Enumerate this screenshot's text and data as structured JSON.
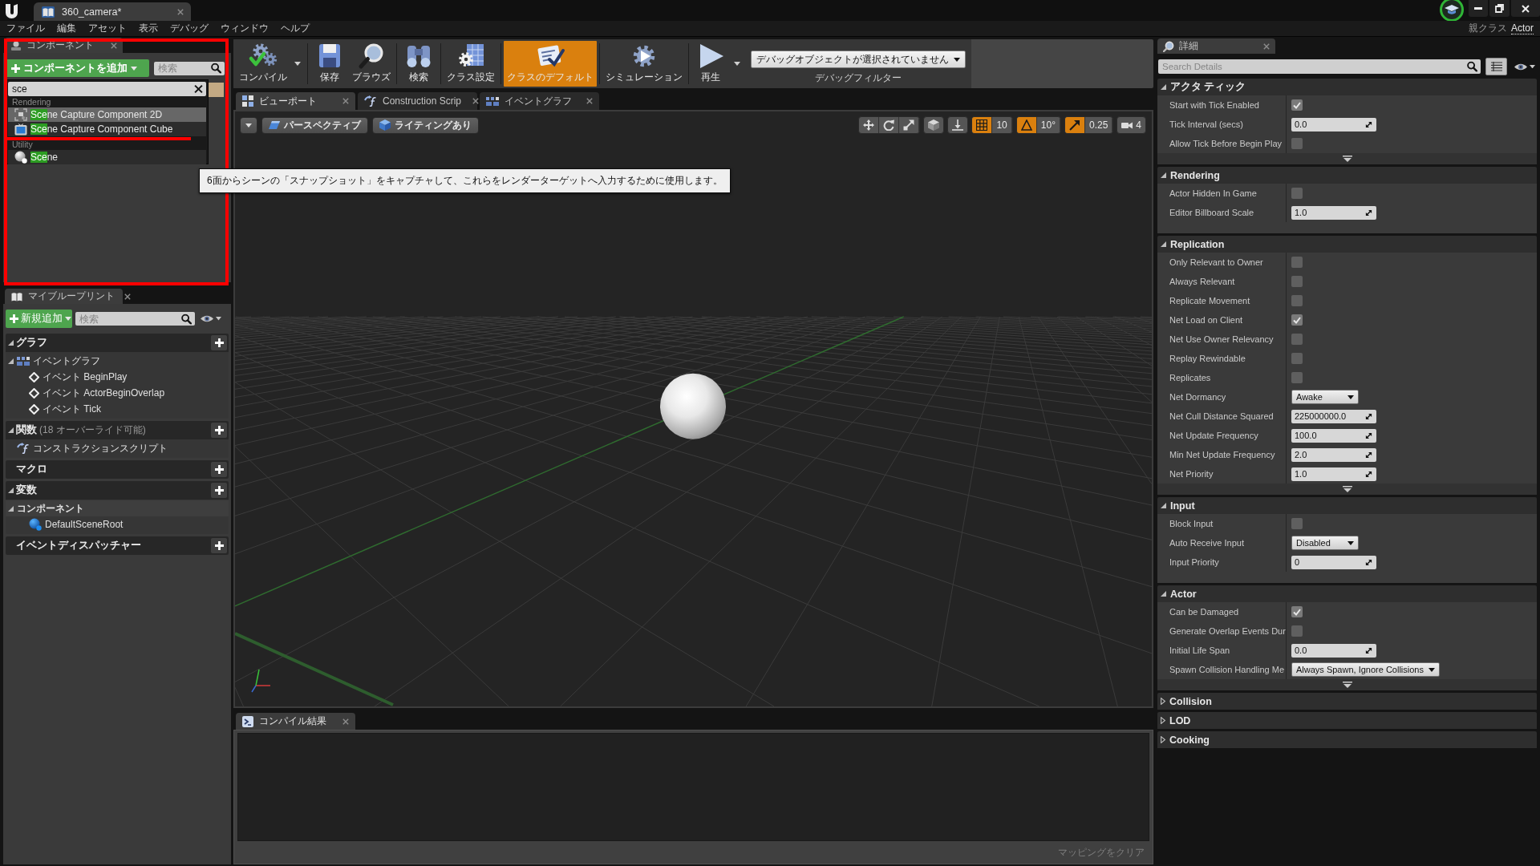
{
  "window": {
    "document_tab": "360_camera*",
    "parent_class_label": "親クラス",
    "parent_class": "Actor"
  },
  "menu": [
    "ファイル",
    "編集",
    "アセット",
    "表示",
    "デバッグ",
    "ウィンドウ",
    "ヘルプ"
  ],
  "components": {
    "tab": "コンポーネント",
    "add_button": "コンポーネントを追加",
    "search": {
      "placeholder": "検索"
    },
    "picker": {
      "query": "sce",
      "groups": [
        {
          "title": "Rendering",
          "items": [
            {
              "kind": "capture",
              "match": "Sce",
              "rest": "ne Capture Component 2D",
              "selected": true
            },
            {
              "kind": "monitor",
              "match": "Sce",
              "rest": "ne Capture Component Cube",
              "selected": false
            }
          ]
        },
        {
          "title": "Utility",
          "items": [
            {
              "kind": "sphere",
              "match": "Sce",
              "rest": "ne",
              "selected": false
            }
          ]
        }
      ]
    },
    "tooltip": "6面からシーンの「スナップショット」をキャプチャして、これらをレンダーターゲットへ入力するために使用します。"
  },
  "my_blueprint": {
    "tab": "マイブループリント",
    "add_button": "新規追加",
    "search": {
      "placeholder": "検索"
    },
    "sections": [
      {
        "title": "グラフ",
        "expanded": true,
        "add": true,
        "items": [
          {
            "kind": "graph",
            "label": "イベントグラフ",
            "expanded": true,
            "children": [
              {
                "kind": "event",
                "label": "イベント BeginPlay"
              },
              {
                "kind": "event",
                "label": "イベント ActorBeginOverlap"
              },
              {
                "kind": "event",
                "label": "イベント Tick"
              }
            ]
          }
        ]
      },
      {
        "title": "関数",
        "note": "(18 オーバーライド可能)",
        "expanded": true,
        "add": true,
        "items": [
          {
            "kind": "function",
            "label": "コンストラクションスクリプト"
          }
        ]
      },
      {
        "title": "マクロ",
        "add": true
      },
      {
        "title": "変数",
        "expanded": true,
        "add": true,
        "items": [
          {
            "kind": "category",
            "label": "コンポーネント",
            "expanded": true,
            "children": [
              {
                "kind": "component",
                "label": "DefaultSceneRoot"
              }
            ]
          }
        ]
      },
      {
        "title": "イベントディスパッチャー",
        "add": true
      }
    ]
  },
  "toolbar": {
    "groups": [
      {
        "buttons": [
          {
            "kind": "compile",
            "label": "コンパイル",
            "selected": false,
            "menu": true
          }
        ]
      },
      {
        "buttons": [
          {
            "kind": "save",
            "label": "保存",
            "selected": false,
            "menu": false
          },
          {
            "kind": "browse",
            "label": "ブラウズ",
            "selected": false,
            "menu": false
          }
        ]
      },
      {
        "buttons": [
          {
            "kind": "find",
            "label": "検索",
            "selected": false,
            "menu": false
          }
        ]
      },
      {
        "buttons": [
          {
            "kind": "class_settings",
            "label": "クラス設定",
            "selected": false,
            "menu": false
          }
        ]
      },
      {
        "buttons": [
          {
            "kind": "class_defaults",
            "label": "クラスのデフォルト",
            "selected": true,
            "menu": false
          }
        ]
      },
      {
        "buttons": [
          {
            "kind": "simulate",
            "label": "シミュレーション",
            "selected": false,
            "menu": false
          }
        ]
      },
      {
        "buttons": [
          {
            "kind": "play",
            "label": "再生",
            "selected": false,
            "menu": true
          }
        ]
      }
    ],
    "debug_filter": {
      "value": "デバッグオブジェクトが選択されていません",
      "label": "デバッグフィルター"
    }
  },
  "editor_tabs": [
    {
      "kind": "viewport",
      "label": "ビューポート",
      "selected": true
    },
    {
      "kind": "function",
      "label": "Construction Scrip",
      "selected": false
    },
    {
      "kind": "graph",
      "label": "イベントグラフ",
      "selected": false
    }
  ],
  "viewport": {
    "view_options": [
      {
        "kind": "projection",
        "label": "パースペクティブ"
      },
      {
        "kind": "view_mode",
        "label": "ライティングあり"
      }
    ],
    "snaps": [
      {
        "kind": "grid",
        "on": true,
        "value": "10"
      },
      {
        "kind": "rotation",
        "on": true,
        "value": "10°"
      },
      {
        "kind": "scale",
        "on": true,
        "value": "0.25"
      }
    ],
    "camera_speed": "4"
  },
  "compile_results": {
    "tab": "コンパイル結果",
    "clear_button": {
      "label": "マッピングをクリア",
      "disabled": true
    }
  },
  "details": {
    "tab": "詳細",
    "search": {
      "placeholder": "Search Details"
    },
    "view_toggle": {
      "on": true
    },
    "categories": [
      {
        "title": "アクタ ティック",
        "expanded": true,
        "advanced": true,
        "properties": [
          {
            "kind": "checkbox",
            "label": "Start with Tick Enabled",
            "checked": true
          },
          {
            "kind": "number",
            "label": "Tick Interval (secs)",
            "value": "0.0"
          },
          {
            "kind": "checkbox",
            "label": "Allow Tick Before Begin Play",
            "checked": false
          }
        ]
      },
      {
        "title": "Rendering",
        "expanded": true,
        "advanced": false,
        "properties": [
          {
            "kind": "checkbox",
            "label": "Actor Hidden In Game",
            "checked": false
          },
          {
            "kind": "number",
            "label": "Editor Billboard Scale",
            "value": "1.0"
          }
        ]
      },
      {
        "title": "Replication",
        "expanded": true,
        "advanced": true,
        "properties": [
          {
            "kind": "checkbox",
            "label": "Only Relevant to Owner",
            "checked": false
          },
          {
            "kind": "checkbox",
            "label": "Always Relevant",
            "checked": false
          },
          {
            "kind": "checkbox",
            "label": "Replicate Movement",
            "checked": false
          },
          {
            "kind": "checkbox",
            "label": "Net Load on Client",
            "checked": true
          },
          {
            "kind": "checkbox",
            "label": "Net Use Owner Relevancy",
            "checked": false
          },
          {
            "kind": "checkbox",
            "label": "Replay Rewindable",
            "checked": false
          },
          {
            "kind": "checkbox",
            "label": "Replicates",
            "checked": false
          },
          {
            "kind": "dropdown",
            "label": "Net Dormancy",
            "value": "Awake"
          },
          {
            "kind": "number",
            "label": "Net Cull Distance Squared",
            "value": "225000000.0"
          },
          {
            "kind": "number",
            "label": "Net Update Frequency",
            "value": "100.0"
          },
          {
            "kind": "number",
            "label": "Min Net Update Frequency",
            "value": "2.0"
          },
          {
            "kind": "number",
            "label": "Net Priority",
            "value": "1.0"
          }
        ]
      },
      {
        "title": "Input",
        "expanded": true,
        "advanced": false,
        "properties": [
          {
            "kind": "checkbox",
            "label": "Block Input",
            "checked": false
          },
          {
            "kind": "dropdown",
            "label": "Auto Receive Input",
            "value": "Disabled"
          },
          {
            "kind": "number",
            "label": "Input Priority",
            "value": "0"
          }
        ]
      },
      {
        "title": "Actor",
        "expanded": true,
        "advanced": true,
        "properties": [
          {
            "kind": "checkbox",
            "label": "Can be Damaged",
            "checked": true
          },
          {
            "kind": "checkbox",
            "label": "Generate Overlap Events Dur",
            "checked": false
          },
          {
            "kind": "number",
            "label": "Initial Life Span",
            "value": "0.0"
          },
          {
            "kind": "dropdown",
            "label": "Spawn Collision Handling Me",
            "value": "Always Spawn, Ignore Collisions"
          }
        ]
      },
      {
        "title": "Collision",
        "expanded": false
      },
      {
        "title": "LOD",
        "expanded": false
      },
      {
        "title": "Cooking",
        "expanded": false
      }
    ]
  }
}
